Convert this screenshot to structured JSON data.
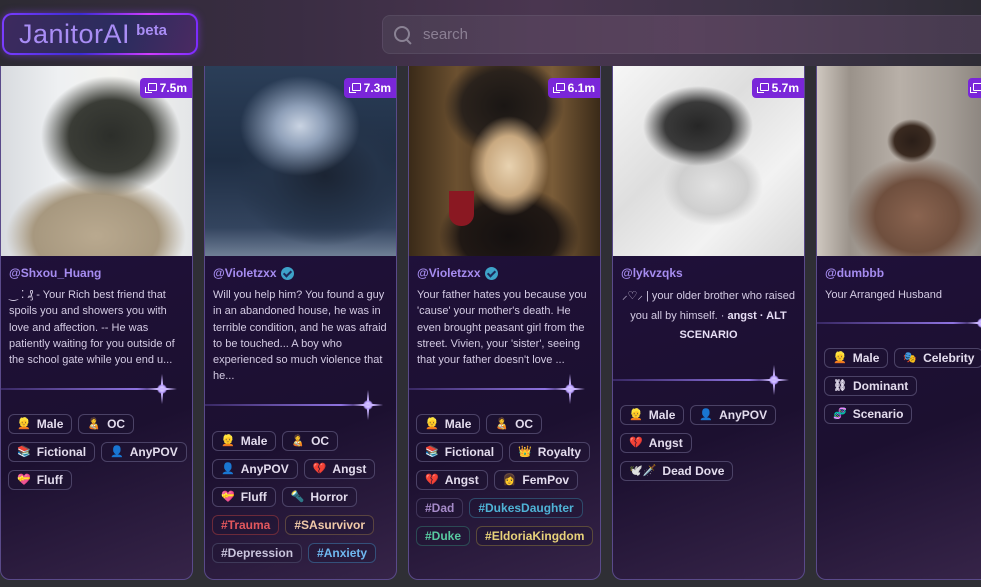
{
  "header": {
    "logo_name": "JanitorAI",
    "logo_badge": "beta",
    "search_placeholder": "search",
    "search_value": ""
  },
  "colors": {
    "accent": "#7a26d9",
    "author": "#a68cf0",
    "card_border": "#5a4a8a"
  },
  "cards": [
    {
      "chats": "7.5m",
      "author": "@Shxou_Huang",
      "verified": false,
      "description": "‿ ⁚ ₰ - Your Rich best friend that spoils you and showers you with love and affection. -- He was patiently waiting for you outside of the school gate while you end u...",
      "tags": [
        {
          "icon": "👱",
          "icon_name": "male-icon",
          "label": "Male"
        },
        {
          "icon": "🧑‍🍼",
          "icon_name": "oc-icon",
          "label": "OC"
        },
        {
          "icon": "📚",
          "icon_name": "fictional-icon",
          "label": "Fictional"
        },
        {
          "icon": "👤",
          "icon_name": "anypov-icon",
          "label": "AnyPOV"
        },
        {
          "icon": "💝",
          "icon_name": "fluff-icon",
          "label": "Fluff"
        }
      ],
      "hashtags": []
    },
    {
      "chats": "7.3m",
      "author": "@Violetzxx",
      "verified": true,
      "description": "Will you help him? You found a guy in an abandoned house, he was in terrible condition, and he was afraid to be touched... A boy who experienced so much violence that he...",
      "tags": [
        {
          "icon": "👱",
          "icon_name": "male-icon",
          "label": "Male"
        },
        {
          "icon": "🧑‍🍼",
          "icon_name": "oc-icon",
          "label": "OC"
        },
        {
          "icon": "👤",
          "icon_name": "anypov-icon",
          "label": "AnyPOV"
        },
        {
          "icon": "💔",
          "icon_name": "angst-icon",
          "label": "Angst"
        },
        {
          "icon": "💝",
          "icon_name": "fluff-icon",
          "label": "Fluff"
        },
        {
          "icon": "🔦",
          "icon_name": "horror-icon",
          "label": "Horror"
        }
      ],
      "hashtags": [
        {
          "label": "#Trauma",
          "color": "#e2575d",
          "border": "#6b2a3a"
        },
        {
          "label": "#SAsurvivor",
          "color": "#f0c9a8",
          "border": "#5a4440"
        },
        {
          "label": "#Depression",
          "color": "#c9c4dc",
          "border": "#3f3a5a"
        },
        {
          "label": "#Anxiety",
          "color": "#6fb8f0",
          "border": "#34507a"
        }
      ]
    },
    {
      "chats": "6.1m",
      "author": "@Violetzxx",
      "verified": true,
      "description": "Your father hates you because you 'cause' your mother's death. He even brought peasant girl from the street. Vivien, your 'sister', seeing that your father doesn't love ...",
      "tags": [
        {
          "icon": "👱",
          "icon_name": "male-icon",
          "label": "Male"
        },
        {
          "icon": "🧑‍🍼",
          "icon_name": "oc-icon",
          "label": "OC"
        },
        {
          "icon": "📚",
          "icon_name": "fictional-icon",
          "label": "Fictional"
        },
        {
          "icon": "👑",
          "icon_name": "royalty-icon",
          "label": "Royalty"
        },
        {
          "icon": "💔",
          "icon_name": "angst-icon",
          "label": "Angst"
        },
        {
          "icon": "👩",
          "icon_name": "fempov-icon",
          "label": "FemPov"
        }
      ],
      "hashtags": [
        {
          "label": "#Dad",
          "color": "#a58ac8",
          "border": "#3f3458"
        },
        {
          "label": "#DukesDaughter",
          "color": "#4fb3d6",
          "border": "#2e4a6a"
        },
        {
          "label": "#Duke",
          "color": "#58c9a0",
          "border": "#2c4a54"
        },
        {
          "label": "#EldoriaKingdom",
          "color": "#e8d27a",
          "border": "#5a4a3a"
        }
      ]
    },
    {
      "chats": "5.7m",
      "author": "@lykvzqks",
      "verified": false,
      "description_html_parts": [
        "⸝♡⸝ | your older brother who raised you all by himself. · ",
        "angst · ALT SCENARIO"
      ],
      "tags": [
        {
          "icon": "👱",
          "icon_name": "male-icon",
          "label": "Male"
        },
        {
          "icon": "👤",
          "icon_name": "anypov-icon",
          "label": "AnyPOV"
        },
        {
          "icon": "💔",
          "icon_name": "angst-icon",
          "label": "Angst"
        },
        {
          "icon": "🕊️🗡️",
          "icon_name": "dead-dove-icon",
          "label": "Dead Dove"
        }
      ],
      "hashtags": []
    },
    {
      "chats": "",
      "author": "@dumbbb",
      "verified": false,
      "description": "Your Arranged Husband",
      "tags": [
        {
          "icon": "👱",
          "icon_name": "male-icon",
          "label": "Male"
        },
        {
          "icon": "🎭",
          "icon_name": "celebrity-icon",
          "label": "Celebrity"
        },
        {
          "icon": "⛓",
          "icon_name": "dominant-icon",
          "label": "Dominant"
        },
        {
          "icon": "🧬",
          "icon_name": "scenario-icon",
          "label": "Scenario"
        }
      ],
      "hashtags": []
    }
  ]
}
